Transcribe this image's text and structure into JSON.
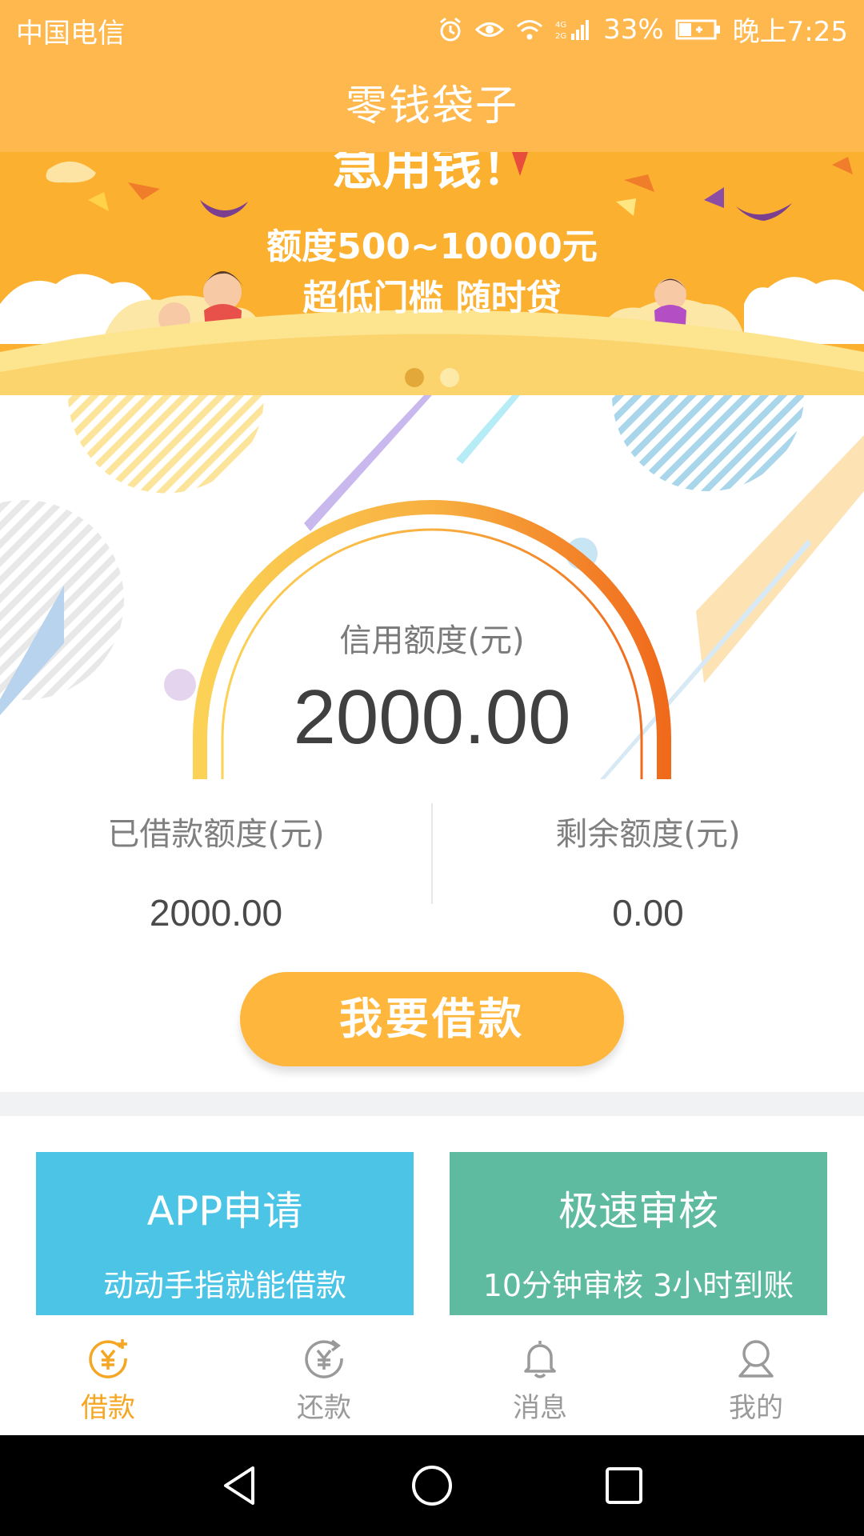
{
  "status_bar": {
    "carrier": "中国电信",
    "battery_percent": "33%",
    "time": "晚上7:25",
    "network": "4G 2G"
  },
  "app": {
    "title": "零钱袋子"
  },
  "banner": {
    "line0": "急用钱！",
    "line1": "额度500~10000元",
    "line2": "超低门槛 随时贷",
    "active_index": 0,
    "dot_count": 2
  },
  "credit": {
    "label": "信用额度(元)",
    "value": "2000.00"
  },
  "stats": {
    "borrowed_label": "已借款额度(元)",
    "borrowed_value": "2000.00",
    "remaining_label": "剩余额度(元)",
    "remaining_value": "0.00"
  },
  "borrow_button": {
    "label": "我要借款"
  },
  "cards": [
    {
      "title": "APP申请",
      "subtitle": "动动手指就能借款"
    },
    {
      "title": "极速审核",
      "subtitle": "10分钟审核 3小时到账"
    }
  ],
  "nav": [
    {
      "label": "借款",
      "icon": "yen-plus-icon",
      "active": true
    },
    {
      "label": "还款",
      "icon": "yen-return-icon",
      "active": false
    },
    {
      "label": "消息",
      "icon": "bell-icon",
      "active": false
    },
    {
      "label": "我的",
      "icon": "user-icon",
      "active": false
    }
  ],
  "colors": {
    "brand": "#ffb84d",
    "button": "#ffb63c",
    "nav_active": "#f5a623",
    "nav_inactive": "#9a9a9a",
    "card_blue": "#4cc4e6",
    "card_green": "#5fbba0"
  }
}
